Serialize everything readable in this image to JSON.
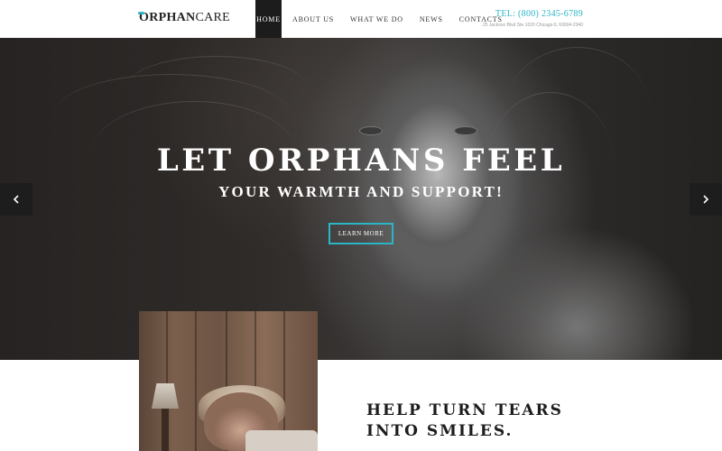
{
  "header": {
    "logo": {
      "bold": "ORPHAN",
      "light": "CARE"
    },
    "nav": [
      {
        "label": "HOME",
        "active": true
      },
      {
        "label": "ABOUT US",
        "active": false
      },
      {
        "label": "WHAT WE DO",
        "active": false
      },
      {
        "label": "NEWS",
        "active": false
      },
      {
        "label": "CONTACTS",
        "active": false
      }
    ],
    "contact": {
      "tel": "TEL: (800) 2345-6789",
      "address": "25 Jackson Blvd Ste 1020 Chicago IL 60604-2340"
    }
  },
  "hero": {
    "title": "LET ORPHANS FEEL",
    "subtitle": "YOUR WARMTH AND SUPPORT!",
    "button_label": "LEARN MORE",
    "prev_icon": "chevron-left-icon",
    "next_icon": "chevron-right-icon"
  },
  "section": {
    "heading_line1": "HELP TURN TEARS",
    "heading_line2": "INTO SMILES."
  },
  "colors": {
    "accent": "#2ab6c6",
    "dark": "#1c1c1c",
    "white": "#ffffff"
  }
}
